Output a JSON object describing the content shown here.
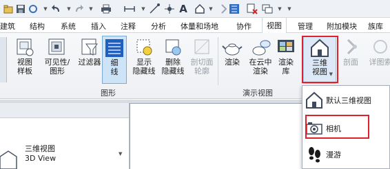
{
  "tabs": [
    "建筑",
    "结构",
    "系统",
    "插入",
    "注释",
    "分析",
    "体量和场地",
    "协作",
    "视图",
    "管理",
    "附加模块",
    "族库"
  ],
  "active_tab": "视图",
  "ribbon": {
    "buttons": [
      {
        "line1": "视图",
        "line2": "样板"
      },
      {
        "line1": "可见性/",
        "line2": "图形"
      },
      {
        "line1": "过滤器",
        "line2": ""
      },
      {
        "line1": "细",
        "line2": "线"
      },
      {
        "line1": "显示",
        "line2": "隐藏线"
      },
      {
        "line1": "删除",
        "line2": "隐藏线"
      },
      {
        "line1": "剖切面",
        "line2": "轮廓"
      },
      {
        "line1": "渲染",
        "line2": ""
      },
      {
        "line1": "在云中",
        "line2": "渲染"
      },
      {
        "line1": "渲染",
        "line2": "库"
      },
      {
        "line1": "三维",
        "line2": "视图"
      },
      {
        "line1": "剖面",
        "line2": ""
      },
      {
        "line1": "详图索",
        "line2": ""
      }
    ],
    "panels": {
      "graphics": "图形",
      "presentation": "演示视图"
    }
  },
  "dropdown": {
    "items": [
      {
        "label": "默认三维视图",
        "icon": "house-icon"
      },
      {
        "label": "相机",
        "icon": "camera-icon"
      },
      {
        "label": "漫游",
        "icon": "footprints-icon"
      }
    ]
  },
  "properties": {
    "type_name": "三维视图",
    "type_name_en": "3D View"
  },
  "colors": {
    "highlight_red": "#e0202a",
    "active_button_blue": "#cde3f7"
  }
}
